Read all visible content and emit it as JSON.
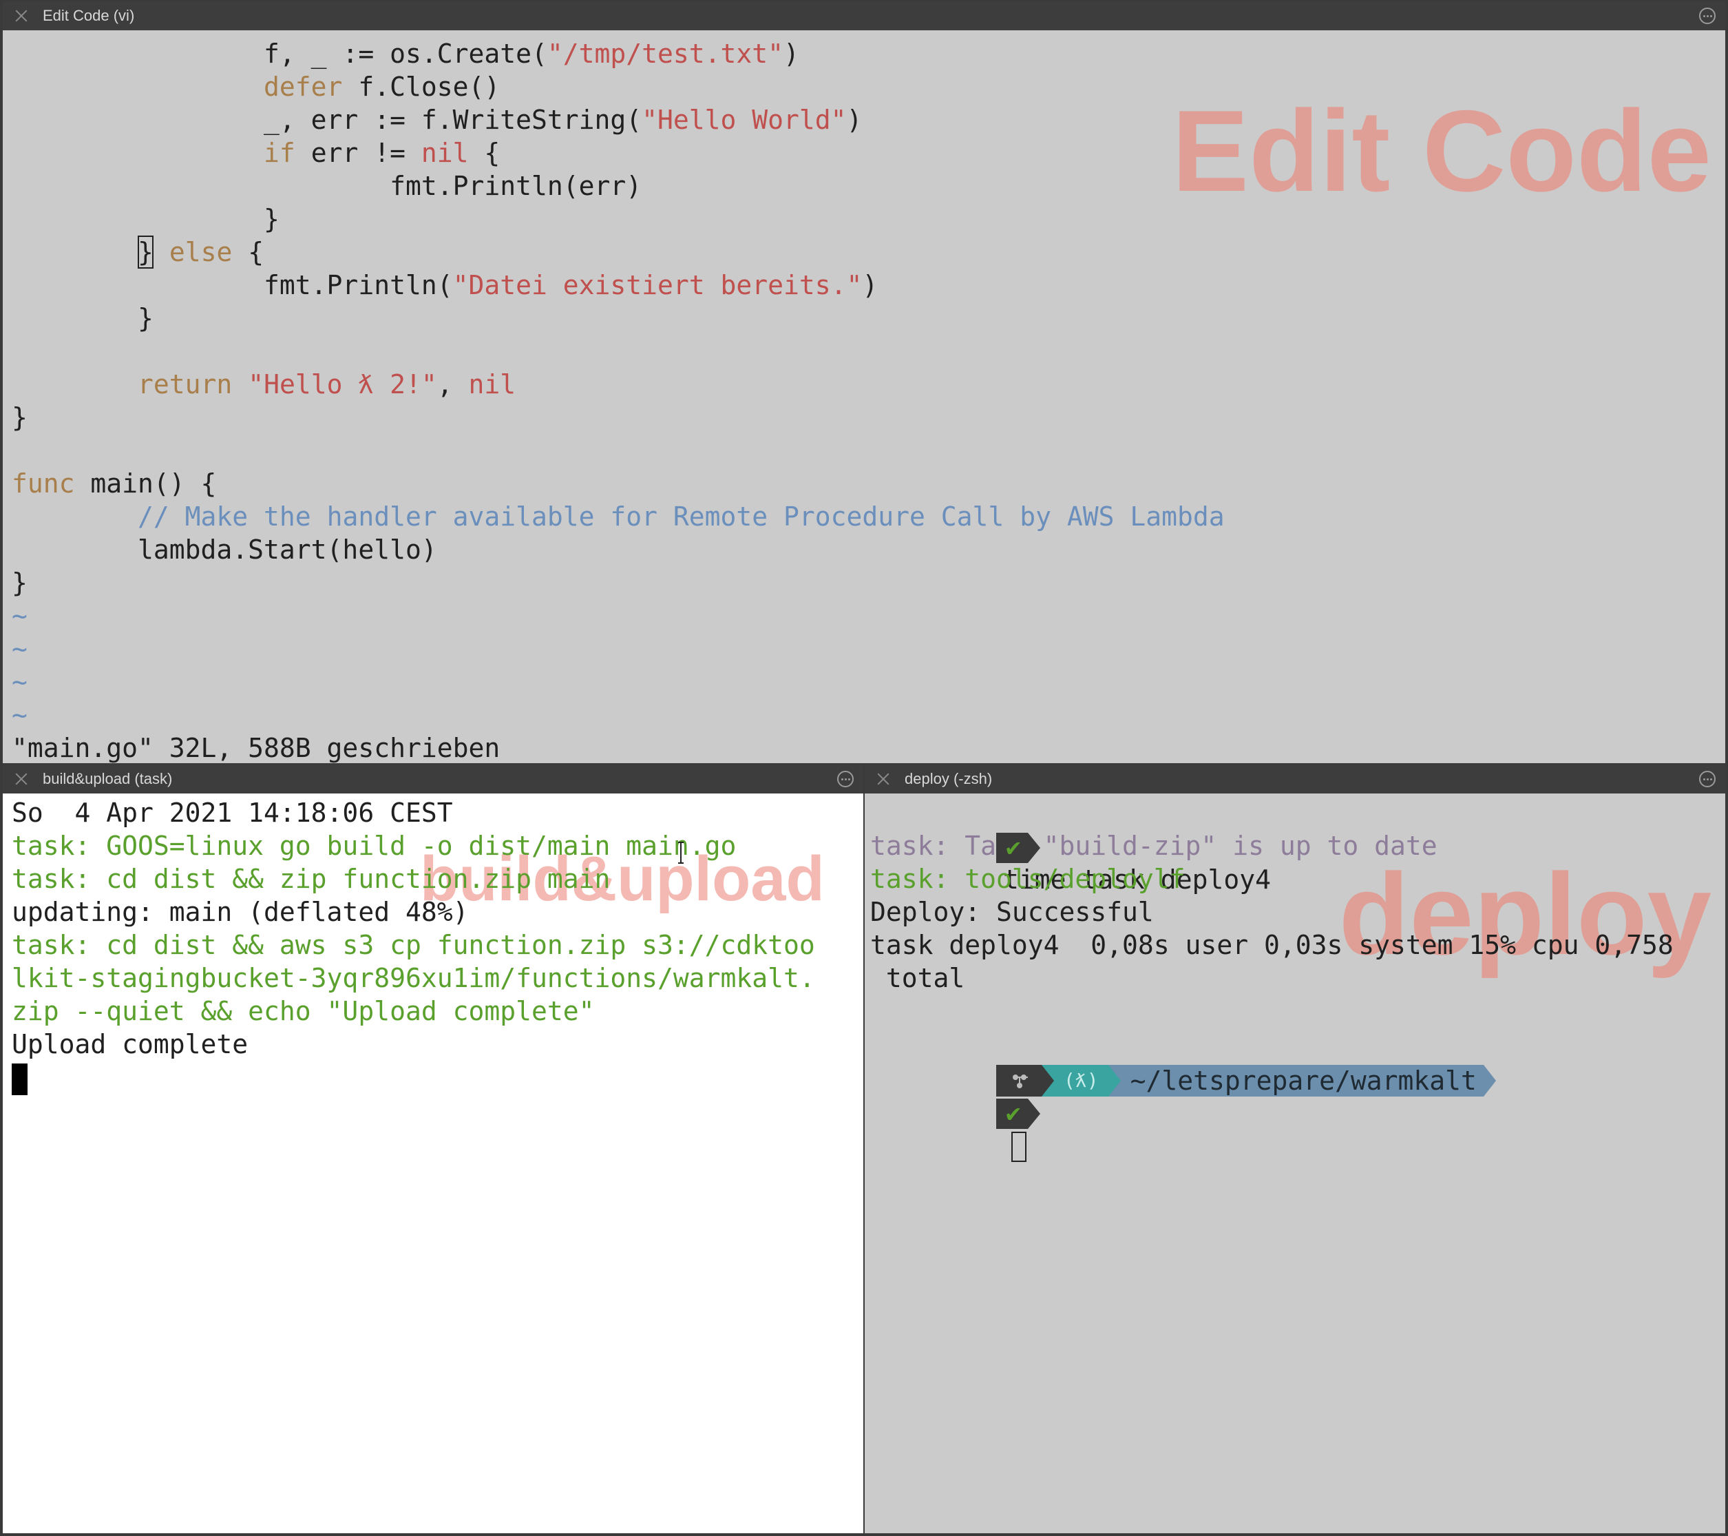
{
  "editor": {
    "title": "Edit Code (vi)",
    "watermark": "Edit Code",
    "lines": [
      [
        {
          "t": "                f, _ := os.Create(",
          "c": "pl"
        },
        {
          "t": "\"/tmp/test.txt\"",
          "c": "str"
        },
        {
          "t": ")",
          "c": "pl"
        }
      ],
      [
        {
          "t": "                ",
          "c": "pl"
        },
        {
          "t": "defer",
          "c": "kw"
        },
        {
          "t": " f.Close()",
          "c": "pl"
        }
      ],
      [
        {
          "t": "                _, err := f.WriteString(",
          "c": "pl"
        },
        {
          "t": "\"Hello World\"",
          "c": "str"
        },
        {
          "t": ")",
          "c": "pl"
        }
      ],
      [
        {
          "t": "                ",
          "c": "pl"
        },
        {
          "t": "if",
          "c": "kw"
        },
        {
          "t": " err != ",
          "c": "pl"
        },
        {
          "t": "nil",
          "c": "str"
        },
        {
          "t": " {",
          "c": "pl"
        }
      ],
      [
        {
          "t": "                        fmt.Println(err)",
          "c": "pl"
        }
      ],
      [
        {
          "t": "                }",
          "c": "pl"
        }
      ],
      [
        {
          "t": "        ",
          "c": "pl"
        },
        {
          "t": "}",
          "c": "pl cursorbox"
        },
        {
          "t": " ",
          "c": "pl"
        },
        {
          "t": "else",
          "c": "kw"
        },
        {
          "t": " {",
          "c": "pl"
        }
      ],
      [
        {
          "t": "                fmt.Println(",
          "c": "pl"
        },
        {
          "t": "\"Datei existiert bereits.\"",
          "c": "str"
        },
        {
          "t": ")",
          "c": "pl"
        }
      ],
      [
        {
          "t": "        }",
          "c": "pl"
        }
      ],
      [
        {
          "t": "",
          "c": "pl"
        }
      ],
      [
        {
          "t": "        ",
          "c": "pl"
        },
        {
          "t": "return",
          "c": "kw"
        },
        {
          "t": " ",
          "c": "pl"
        },
        {
          "t": "\"Hello ƛ 2!\"",
          "c": "str"
        },
        {
          "t": ", ",
          "c": "pl"
        },
        {
          "t": "nil",
          "c": "str"
        }
      ],
      [
        {
          "t": "}",
          "c": "pl"
        }
      ],
      [
        {
          "t": "",
          "c": "pl"
        }
      ],
      [
        {
          "t": "func",
          "c": "kw"
        },
        {
          "t": " main() {",
          "c": "pl"
        }
      ],
      [
        {
          "t": "        ",
          "c": "pl"
        },
        {
          "t": "// Make the handler available for Remote Procedure Call by AWS Lambda",
          "c": "cm"
        }
      ],
      [
        {
          "t": "        lambda.Start(hello)",
          "c": "pl"
        }
      ],
      [
        {
          "t": "}",
          "c": "pl"
        }
      ],
      [
        {
          "t": "~",
          "c": "tl"
        }
      ],
      [
        {
          "t": "~",
          "c": "tl"
        }
      ],
      [
        {
          "t": "~",
          "c": "tl"
        }
      ],
      [
        {
          "t": "~",
          "c": "tl"
        }
      ],
      [
        {
          "t": "\"main.go\" 32L, 588B geschrieben",
          "c": "pl"
        }
      ]
    ]
  },
  "build": {
    "title": "build&upload (task)",
    "watermark": "build&upload",
    "lines": [
      [
        {
          "t": "So  4 Apr 2021 14:18:06 CEST",
          "c": "pl"
        }
      ],
      [
        {
          "t": "task: GOOS=linux go build -o dist/main main.go",
          "c": "g"
        }
      ],
      [
        {
          "t": "task: cd dist && zip function.zip main",
          "c": "g"
        }
      ],
      [
        {
          "t": "updating: main (deflated 48%)",
          "c": "pl"
        }
      ],
      [
        {
          "t": "task: cd dist && aws s3 cp function.zip s3://cdktoo",
          "c": "g"
        }
      ],
      [
        {
          "t": "lkit-stagingbucket-3yqr896xu1im/functions/warmkalt.",
          "c": "g"
        }
      ],
      [
        {
          "t": "zip --quiet && echo \"Upload complete\"",
          "c": "g"
        }
      ],
      [
        {
          "t": "Upload complete",
          "c": "pl"
        }
      ]
    ]
  },
  "deploy": {
    "title": "deploy (-zsh)",
    "watermark": "deploy",
    "command": "time task deploy4",
    "check": "✔",
    "lines": [
      [
        {
          "t": "task: Task \"build-zip\" is up to date",
          "c": "pu"
        }
      ],
      [
        {
          "t": "task: tools/deploylf",
          "c": "g"
        }
      ],
      [
        {
          "t": "Deploy: Successful",
          "c": "pl"
        }
      ],
      [
        {
          "t": "task deploy4  0,08s user 0,03s system 15% cpu 0,758",
          "c": "pl"
        }
      ],
      [
        {
          "t": " total",
          "c": "pl"
        }
      ]
    ],
    "prompt_path": "~/letsprepare/warmkalt",
    "prompt_lambda": "(ƛ)"
  },
  "colors": {
    "editor_bg": "#cbcbcb",
    "build_bg": "#ffffff",
    "deploy_bg": "#cbcbcb",
    "watermark": "#e09f96",
    "watermark_light": "#f4b9b3",
    "prompt_dark": "#3a3a3a",
    "prompt_teal": "#3aa5a0",
    "prompt_blue": "#6b8fad"
  },
  "icons": {
    "close": "close-icon",
    "more": "ellipsis-circle-icon",
    "check": "checkmark-icon",
    "git": "git-branch-icon",
    "ibeam": "text-cursor-icon"
  }
}
